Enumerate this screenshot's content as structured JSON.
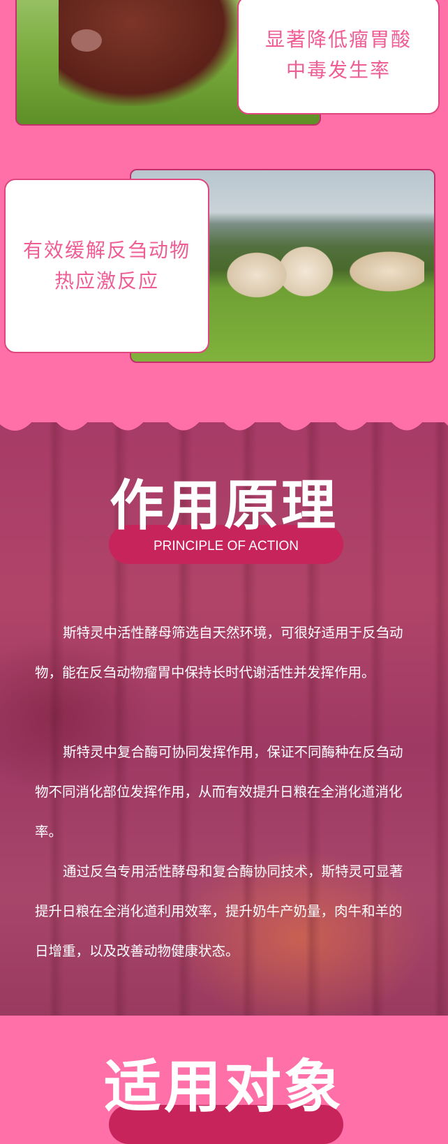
{
  "features": [
    {
      "text_line1": "显著降低瘤胃酸",
      "text_line2": "中毒发生率"
    },
    {
      "text_line1": "有效缓解反刍动物",
      "text_line2": "热应激反应"
    }
  ],
  "principle": {
    "title": "作用原理",
    "subtitle": "PRINCIPLE OF ACTION",
    "paragraphs": [
      "斯特灵中活性酵母筛选自天然环境，可很好适用于反刍动物，能在反刍动物瘤胃中保持长时代谢活性并发挥作用。",
      "斯特灵中复合酶可协同发挥作用，保证不同酶种在反刍动物不同消化部位发挥作用，从而有效提升日粮在全消化道消化率。",
      "通过反刍专用活性酵母和复合酶协同技术，斯特灵可显著提升日粮在全消化道利用效率，提升奶牛产奶量，肉牛和羊的日增重，以及改善动物健康状态。"
    ]
  },
  "applicable": {
    "title": "适用对象"
  },
  "colors": {
    "background": "#ff6fa8",
    "card_text": "#ee5e95",
    "pill": "#c8245c"
  }
}
